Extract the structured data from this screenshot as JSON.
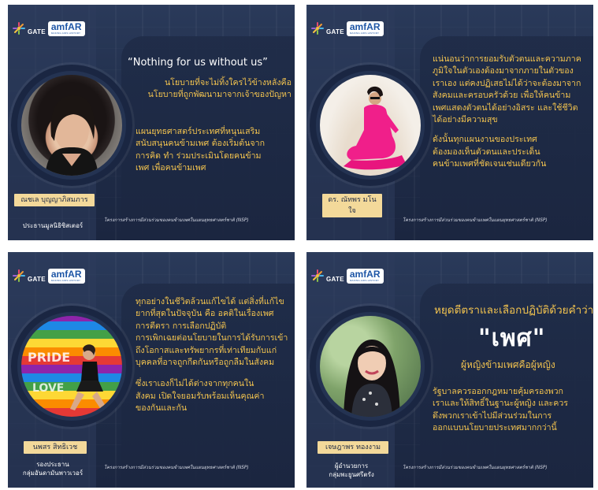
{
  "logo": {
    "gate": "GATE",
    "amfar": "amfAR"
  },
  "footer": "โครงการสร้างการมีส่วนร่วมของคนข้ามเพศในแผนยุทธศาสตร์ชาติ (NSP)",
  "cards": [
    {
      "quote": "“Nothing for us without us”",
      "lines": [
        "นโยบายที่จะไม่ทิ้งใครไว้ข้างหลังคือ",
        "นโยบายที่ถูกพัฒนามาจากเจ้าของปัญหา",
        "",
        "แผนยุทธศาสตร์ประเทศที่หนุนเสริม",
        "สนับสนุนคนข้ามเพศ ต้องเริ่มต้นจาก",
        "การคิด ทำ ร่วมประเมินโดยคนข้าม",
        "เพศ เพื่อคนข้ามเพศ"
      ],
      "name": "ณชเล บุญญาภิสมภาร",
      "role": "ประธานมูลนิธิซิสเตอร์"
    },
    {
      "lines": [
        "แน่นอนว่าการยอมรับตัวตนและความภาค",
        "ภูมิใจในตัวเองต้องมาจากภายในตัวของ",
        "เราเอง แต่คงปฏิเสธไม่ได้ว่าจะต้องมาจาก",
        "สังคมและครอบครัวด้วย เพื่อให้คนข้าม",
        "เพศแสดงตัวตนได้อย่างอิสระ และใช้ชีวิต",
        "ได้อย่างมีความสุข",
        "",
        "ดังนั้นทุกแผนงานของประเทศ",
        "ต้องมองเห็นตัวตนและประเด็น",
        "คนข้ามเพศที่ชัดเจนเช่นเดียวกัน"
      ],
      "name": "ดร. ณัทพร มโนใจ"
    },
    {
      "lines": [
        "ทุกอย่างในชีวิตล้วนแก้ไขได้ แต่สิ่งที่แก้ไข",
        "ยากที่สุดในปัจจุบัน คือ อคติในเรื่องเพศ",
        "การตีตรา การเลือกปฏิบัติ",
        "การเพิกเฉยต่อนโยบายในการได้รับการเข้า",
        "ถึงโอกาสและทรัพยากรที่เท่าเทียมกับแก่",
        "บุคคลที่อาจถูกกีดกันหรือถูกลืมในสังคม",
        "",
        "ซึ่งเราเองก็ไม่ได้ต่างจากทุกคนใน",
        "สังคม เปิดใจยอมรับพร้อมเห็นคุณค่า",
        "ของกันและกัน"
      ],
      "name": "นพสร สิทธิเวช",
      "role_lines": [
        "รองประธาน",
        "กลุ่มอันดามันพาวเวอร์"
      ]
    },
    {
      "heading": "หยุดตีตราและเลือกปฏิบัติด้วยคำว่า",
      "bigword": "\"เพศ\"",
      "subheading": "ผู้หญิงข้ามเพศคือผู้หญิง",
      "lines": [
        "รัฐบาลควรออกกฎหมายคุ้มครองพวก",
        "เราและให้สิทธิ์ในฐานะผู้หญิง และควร",
        "ดึงพวกเราเข้าไปมีส่วนร่วมในการ",
        "ออกแบบนโยบายประเทศมากกว่านี้"
      ],
      "name": "เจษฎาพร ทองงาม",
      "role_lines": [
        "ผู้อำนวยการ",
        "กลุ่มพะยูนศรีตรัง"
      ]
    }
  ]
}
